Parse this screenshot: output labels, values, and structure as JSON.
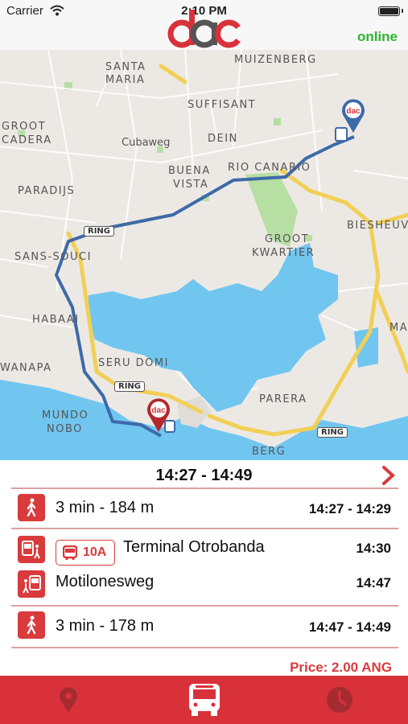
{
  "status_bar": {
    "carrier": "Carrier",
    "time": "2:10 PM"
  },
  "header": {
    "logo": "dac",
    "connection_status": "online"
  },
  "map": {
    "labels": {
      "muizenberg": "MUIZENBERG",
      "santa_maria_1": "SANTA",
      "santa_maria_2": "MARIA",
      "suffisant": "SUFFISANT",
      "groot_1": "GROOT",
      "cadera": "CADERA",
      "cubaweg": "Cubaweg",
      "dein": "DEIN",
      "buena": "BUENA",
      "vista": "VISTA",
      "rio_canario": "RIO CANARIO",
      "paradijs": "PARADIJS",
      "biesheuvel": "BIESHEUVEL",
      "groot_2": "GROOT",
      "kwartier": "KWARTIER",
      "sans_souci": "SANS-SOUCI",
      "habaai": "HABAAI",
      "ma": "MA",
      "seru_domi": "SERU DOMI",
      "wanapa": "WANAPA",
      "parera": "PARERA",
      "mundo": "MUNDO",
      "nobo": "NOBO",
      "berg": "BERG"
    },
    "ring_badges": [
      "RING",
      "RING",
      "RING"
    ],
    "route_color": "#3d6aa8",
    "highway_color": "#f2cf56",
    "water_color": "#71c6f0",
    "marker_start": "dac",
    "marker_end": "dac"
  },
  "trip": {
    "time_range": "14:27 - 14:49",
    "steps": [
      {
        "type": "walk",
        "icon": "walking-person-icon",
        "text": "3 min - 184 m",
        "time": "14:27 - 14:29"
      },
      {
        "type": "board",
        "icon": "bus-board-icon",
        "line": "10A",
        "text": "Terminal Otrobanda",
        "time": "14:30"
      },
      {
        "type": "alight",
        "icon": "bus-alight-icon",
        "text": "Motilonesweg",
        "time": "14:47"
      },
      {
        "type": "walk",
        "icon": "walking-person-icon",
        "text": "3 min - 178 m",
        "time": "14:47 - 14:49"
      }
    ],
    "price": "Price: 2.00 ANG"
  },
  "colors": {
    "accent": "#d93a3c",
    "online": "#2db62d",
    "tab_bar": "#d8313a"
  },
  "tabs": [
    {
      "icon": "map-pin-icon",
      "active": false
    },
    {
      "icon": "bus-icon",
      "active": true
    },
    {
      "icon": "clock-icon",
      "active": false
    }
  ]
}
